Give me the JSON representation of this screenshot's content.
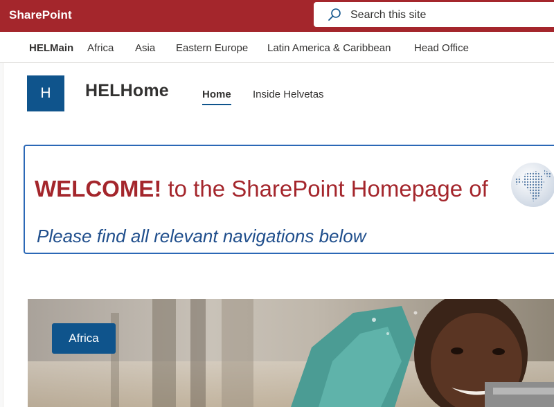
{
  "suite": {
    "app_name": "SharePoint",
    "search_placeholder": "Search this site"
  },
  "hub_nav": {
    "home": "HELMain",
    "items": [
      "Africa",
      "Asia",
      "Eastern Europe",
      "Latin America & Caribbean",
      "Head Office"
    ]
  },
  "site": {
    "logo_letter": "H",
    "title": "HELHome",
    "nav": [
      {
        "label": "Home",
        "active": true
      },
      {
        "label": "Inside Helvetas",
        "active": false
      }
    ]
  },
  "banner": {
    "welcome_strong": "WELCOME!",
    "welcome_rest": " to the SharePoint Homepage of",
    "subtitle": "Please find all relevant navigations below"
  },
  "hero": {
    "button_label": "Africa"
  },
  "colors": {
    "suite_bar": "#a4262c",
    "theme_primary": "#0f548c",
    "banner_border": "#2b68b6",
    "welcome_text": "#a4262c",
    "subtitle_text": "#1f4e8c"
  },
  "icons": {
    "search": "search-icon",
    "globe": "globe-icon"
  }
}
